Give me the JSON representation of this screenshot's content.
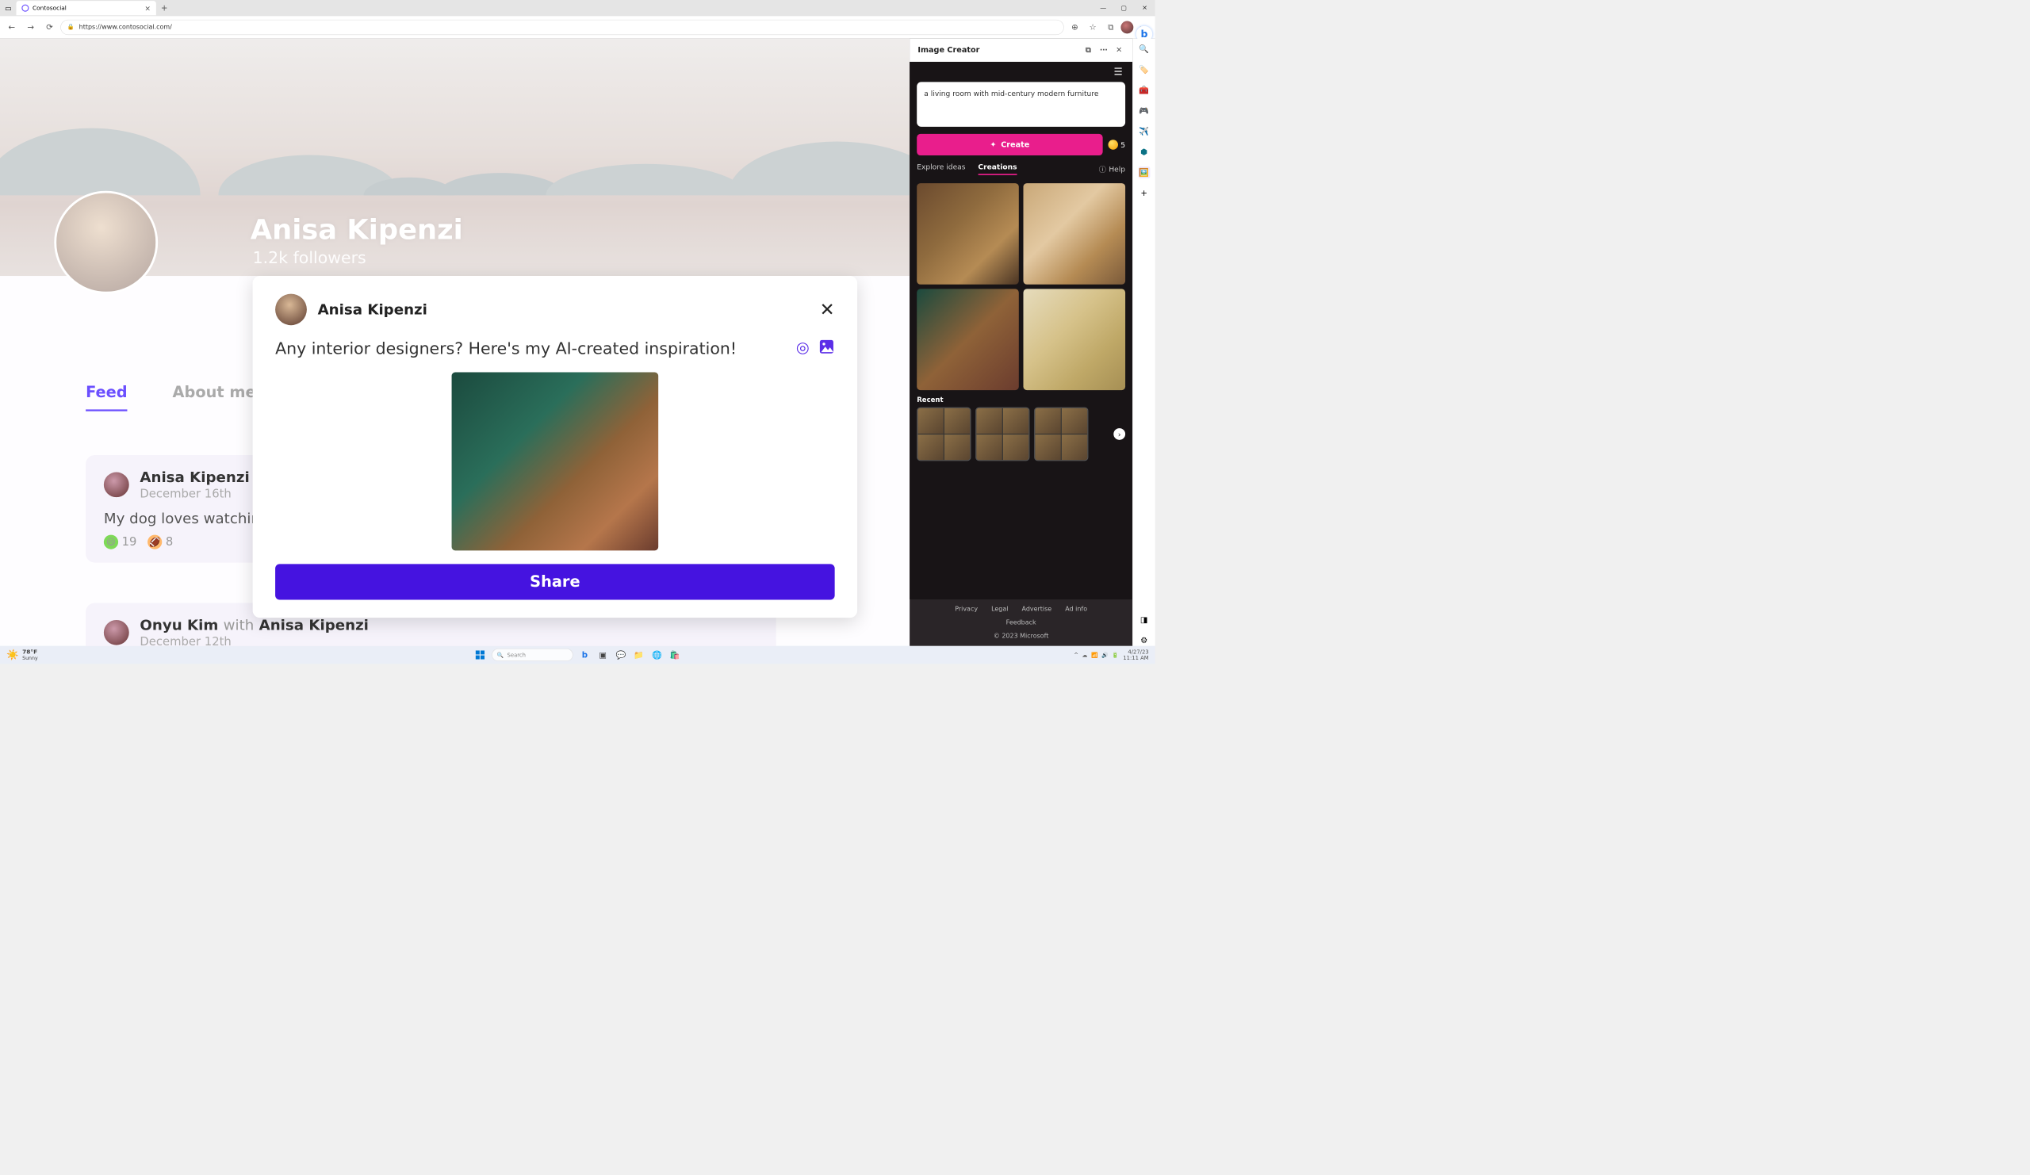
{
  "browser": {
    "tab_title": "Contosocial",
    "url": "https://www.contosocial.com/"
  },
  "profile": {
    "name": "Anisa Kipenzi",
    "followers": "1.2k followers"
  },
  "page_tabs": {
    "feed": "Feed",
    "about": "About me"
  },
  "feed_posts": [
    {
      "user": "Anisa Kipenzi",
      "date": "December 16th",
      "body": "My dog loves watching",
      "r1": "19",
      "r2": "8"
    },
    {
      "user": "Onyu Kim",
      "with": "with",
      "tagged": "Anisa Kipenzi",
      "date": "December 12th"
    }
  ],
  "compose": {
    "user": "Anisa Kipenzi",
    "text": "Any interior designers? Here's my AI-created inspiration!",
    "share": "Share"
  },
  "image_creator": {
    "title": "Image Creator",
    "prompt": "a living room with mid-century modern furniture",
    "create": "Create",
    "tokens": "5",
    "tabs": {
      "explore": "Explore ideas",
      "creations": "Creations"
    },
    "help": "Help",
    "recent_label": "Recent",
    "footer_links": [
      "Privacy",
      "Legal",
      "Advertise",
      "Ad info"
    ],
    "feedback": "Feedback",
    "copyright": "© 2023 Microsoft"
  },
  "taskbar": {
    "weather_temp": "78°F",
    "weather_cond": "Sunny",
    "search_placeholder": "Search",
    "date": "4/27/23",
    "time": "11:11 AM"
  }
}
